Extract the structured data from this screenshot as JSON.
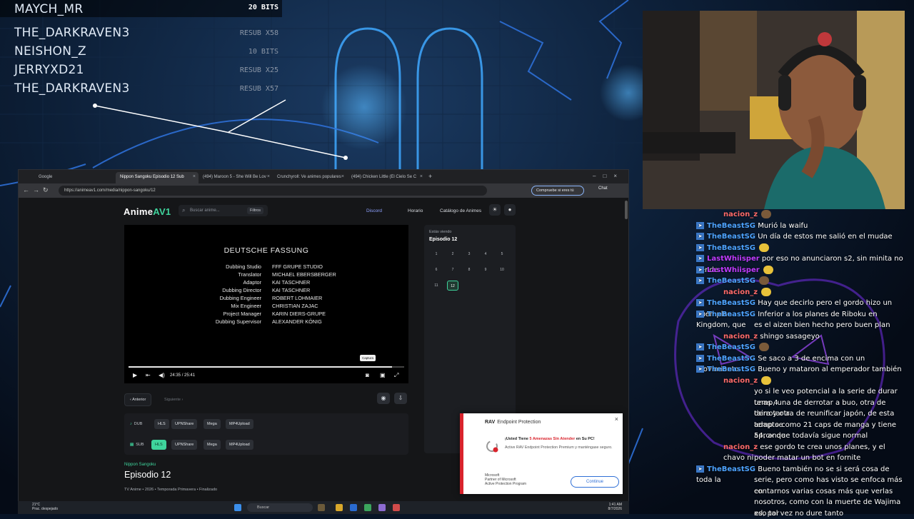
{
  "stream_alerts": [
    {
      "name": "MAYCH_MR",
      "type": "20 BITS"
    },
    {
      "name": "THE_DARKRAVEN3",
      "type": "RESUB X58"
    },
    {
      "name": "NEISHON_Z",
      "type": "10 BITS"
    },
    {
      "name": "JERRYXD21",
      "type": "RESUB X25"
    },
    {
      "name": "THE_DARKRAVEN3",
      "type": "RESUB X57"
    }
  ],
  "browser": {
    "tabs": [
      {
        "label": "Google"
      },
      {
        "label": "Nippon Sangoku Episodio 12 Sub"
      },
      {
        "label": "(494) Maroon 5 - She Will Be Lov"
      },
      {
        "label": "Crunchyroll: Ve animes populares"
      },
      {
        "label": "(494) Chicken Little (El Cielo Se C"
      }
    ],
    "url": "https://animeav1.com/media/nippon-sangoku/12",
    "compruebe_label": "Compruebe si eres tú",
    "chat_label": "Chat"
  },
  "site": {
    "logo_main": "Anime",
    "logo_accent": "AV1",
    "search_placeholder": "Buscar anime...",
    "filters_label": "Filtros",
    "nav": [
      "Discord",
      "Horario",
      "Catálogo de Animes"
    ],
    "player": {
      "credits_title": "DEUTSCHE FASSUNG",
      "credits": [
        {
          "role": "Dubbing Studio",
          "name": "FFF GRUPE STUDIO"
        },
        {
          "role": "Translator",
          "name": "MICHAEL EBERSBERGER"
        },
        {
          "role": "Adaptor",
          "name": "KAI TASCHNER"
        },
        {
          "role": "Dubbing Director",
          "name": "KAI TASCHNER"
        },
        {
          "role": "Dubbing Engineer",
          "name": "ROBERT LOHMAIER"
        },
        {
          "role": "Mix Engineer",
          "name": "CHRISTIAN ZAJAC"
        },
        {
          "role": "Project Manager",
          "name": "KARIN DIERS-GRUPE"
        },
        {
          "role": "Dubbing Supervisor",
          "name": "ALEXANDER KÖNIG"
        }
      ],
      "current_time": "24:35",
      "duration": "25:41",
      "time_separator": "/",
      "progress": 0.957,
      "tooltip": "Captura"
    },
    "prev_label": "Anterior",
    "next_label": "Siguiente",
    "dub": {
      "label": "DUB",
      "servers": [
        "HLS",
        "UPNShare",
        "Mega",
        "MP4Upload"
      ]
    },
    "sub": {
      "label": "SUB",
      "servers": [
        "HLS",
        "UPNShare",
        "Mega",
        "MP4Upload"
      ],
      "active": "HLS"
    },
    "series_name": "Nippon Sangoku",
    "episode_title": "Episodio 12",
    "meta": "TV Anime  •  2026  •  Temporada Primavera  •  Finalizado",
    "viewing_label": "Estás viendo",
    "viewing_episode": "Episodio 12",
    "episodes": [
      "1",
      "2",
      "3",
      "4",
      "5",
      "6",
      "7",
      "8",
      "9",
      "10",
      "11",
      "12"
    ],
    "current_episode": "12"
  },
  "taskbar": {
    "weather_temp": "21°C",
    "weather_desc": "Prac. despejado",
    "search_label": "Buscar",
    "time": "1:41 AM",
    "date": "8/7/2026"
  },
  "popup": {
    "brand": "RAV",
    "product": "Endpoint Protection",
    "title_pre": "¡Usted Tiene ",
    "title_alert": "5 Amenazas Sin Atender",
    "title_post": " en Su PC!",
    "body": "Active RAV Endpoint Protection Premium y manténgase seguro.",
    "ms_name": "Microsoft",
    "ms_line1": "Partner of Microsoft",
    "ms_line2": "Active Protection Program",
    "button": "Continue"
  },
  "chat": [
    {
      "user": "nacion_z",
      "text": "",
      "badge": false,
      "color": "#ff6b6b"
    },
    {
      "user": "TheBeastSG",
      "text": "Murió la waifu",
      "badge": true,
      "color": "#4da3ff"
    },
    {
      "user": "TheBeastSG",
      "text": "Un día de estos me salió en el mudae",
      "badge": true,
      "color": "#4da3ff"
    },
    {
      "user": "TheBeastSG",
      "text": "",
      "badge": true,
      "color": "#4da3ff"
    },
    {
      "user": "LastWhiisper",
      "text": "por eso no anunciaron s2, sin minita no vende",
      "badge": true,
      "color": "#c13cff"
    },
    {
      "user": "LastWhiisper",
      "text": "",
      "badge": true,
      "color": "#c13cff"
    },
    {
      "user": "TheBeastSG",
      "text": "",
      "badge": true,
      "color": "#4da3ff"
    },
    {
      "user": "nacion_z",
      "text": "",
      "badge": false,
      "color": "#ff6b6b"
    },
    {
      "user": "TheBeastSG",
      "text": "Hay que decirlo pero el gordo hizo un buen plan",
      "badge": true,
      "color": "#4da3ff"
    },
    {
      "user": "TheBeastSG",
      "text": "Inferior a los planes de Riboku en Kingdom, que",
      "badge": true,
      "color": "#4da3ff"
    },
    {
      "user": "",
      "text": "es el aizen bien hecho pero buen plan",
      "badge": false,
      "color": "#fff"
    },
    {
      "user": "nacion_z",
      "text": "shingo sasageyo",
      "badge": false,
      "color": "#ff6b6b"
    },
    {
      "user": "TheBeastSG",
      "text": "",
      "badge": true,
      "color": "#4da3ff"
    },
    {
      "user": "TheBeastSG",
      "text": "Se saco a 3 de encima con un movimiento",
      "badge": true,
      "color": "#4da3ff"
    },
    {
      "user": "TheBeastSG",
      "text": "Bueno y mataron al emperador también",
      "badge": true,
      "color": "#4da3ff"
    },
    {
      "user": "nacion_z",
      "text": "",
      "badge": false,
      "color": "#ff6b6b"
    },
    {
      "user": "",
      "text": "yo si le veo potencial a la serie de durar unas 4",
      "badge": false,
      "color": "#fff"
    },
    {
      "user": "",
      "text": "temp, una de derrotar a buo, otra de derrotar a",
      "badge": false,
      "color": "#fff"
    },
    {
      "user": "",
      "text": "taira y otra de reunificar japón, de esta temp se",
      "badge": false,
      "color": "#fff"
    },
    {
      "user": "",
      "text": "adapto como 21 caps de manga y tiene aprox de",
      "badge": false,
      "color": "#fff"
    },
    {
      "user": "",
      "text": "54, anque todavía sigue normal",
      "badge": false,
      "color": "#fff"
    },
    {
      "user": "nacion_z",
      "text": "ese gordo te crea unos planes, y el chavo ni",
      "badge": false,
      "color": "#ff6b6b"
    },
    {
      "user": "",
      "text": "poder matar un bot en fornite",
      "badge": false,
      "color": "#fff"
    },
    {
      "user": "TheBeastSG",
      "text": "Bueno también no se si será cosa de toda la",
      "badge": true,
      "color": "#4da3ff"
    },
    {
      "user": "",
      "text": "serie, pero como has visto se enfoca más en",
      "badge": false,
      "color": "#fff"
    },
    {
      "user": "",
      "text": "contarnos varias cosas más que verlas",
      "badge": false,
      "color": "#fff"
    },
    {
      "user": "",
      "text": "nosotros, como con la muerte de Wajima xd, por",
      "badge": false,
      "color": "#fff"
    },
    {
      "user": "",
      "text": "eso tal vez no dure tanto",
      "badge": false,
      "color": "#fff"
    }
  ]
}
